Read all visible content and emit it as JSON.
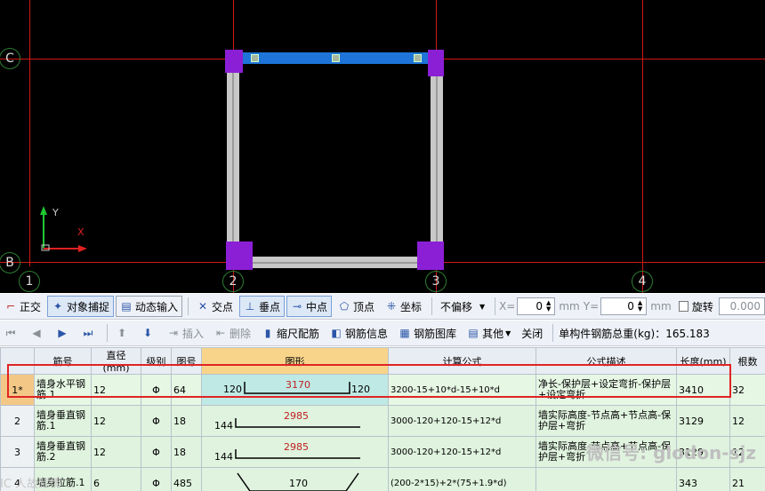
{
  "canvas": {
    "axes_h": [
      "C",
      "B"
    ],
    "axes_v": [
      "1",
      "2",
      "3",
      "4"
    ],
    "ucs": {
      "y": "Y",
      "x": "X"
    },
    "colors": {
      "background": "#000000",
      "grid": "#d01818",
      "wall": "#c8c8c8",
      "corner": "#8b1fd6",
      "selected": "#1e74d8"
    }
  },
  "toolbar1": {
    "ortho": "正交",
    "snap": "对象捕捉",
    "dyn": "动态输入",
    "intersect": "交点",
    "perp": "垂点",
    "mid": "中点",
    "vertex": "顶点",
    "coord": "坐标",
    "offset": "不偏移",
    "x_label": "X=",
    "x_val": "0",
    "mm1": "mm",
    "y_label": "Y=",
    "y_val": "0",
    "mm2": "mm",
    "rotate": "旋转",
    "rotate_val": "0.000"
  },
  "toolbar2": {
    "insert": "插入",
    "delete": "删除",
    "scale": "缩尺配筋",
    "info": "钢筋信息",
    "library": "钢筋图库",
    "other": "其他",
    "close": "关闭",
    "total": "单构件钢筋总重(kg)：165.183"
  },
  "table": {
    "headers": [
      "",
      "筋号",
      "直径(mm)",
      "级别",
      "图号",
      "图形",
      "计算公式",
      "公式描述",
      "长度(mm)",
      "根数"
    ],
    "rows": [
      {
        "idx": "1*",
        "name": "墙身水平钢筋.1",
        "dia": "12",
        "grade": "Φ",
        "fig": "64",
        "s_left": "120",
        "s_mid": "3170",
        "s_right": "120",
        "calc": "3200-15+10*d-15+10*d",
        "desc": "净长-保护层+设定弯折-保护层+设定弯折",
        "len": "3410",
        "cnt": "32"
      },
      {
        "idx": "2",
        "name": "墙身垂直钢筋.1",
        "dia": "12",
        "grade": "Φ",
        "fig": "18",
        "s_left": "144",
        "s_mid": "2985",
        "s_right": "",
        "calc": "3000-120+120-15+12*d",
        "desc": "墙实际高度-节点高+节点高-保护层+弯折",
        "len": "3129",
        "cnt": "12"
      },
      {
        "idx": "3",
        "name": "墙身垂直钢筋.2",
        "dia": "12",
        "grade": "Φ",
        "fig": "18",
        "s_left": "144",
        "s_mid": "2985",
        "s_right": "",
        "calc": "3000-120+120-15+12*d",
        "desc": "墙实际高度-节点高+节点高-保护层+弯折",
        "len": "3129",
        "cnt": "12"
      },
      {
        "idx": "4",
        "name": "墙身拉筋.1",
        "dia": "6",
        "grade": "Φ",
        "fig": "485",
        "s_left": "",
        "s_mid": "170",
        "s_right": "",
        "calc": "(200-2*15)+2*(75+1.9*d)",
        "desc": "",
        "len": "343",
        "cnt": "21"
      }
    ]
  },
  "watermark": "微信号: glodon-sjz",
  "watermark2": "IC 人故踪情"
}
